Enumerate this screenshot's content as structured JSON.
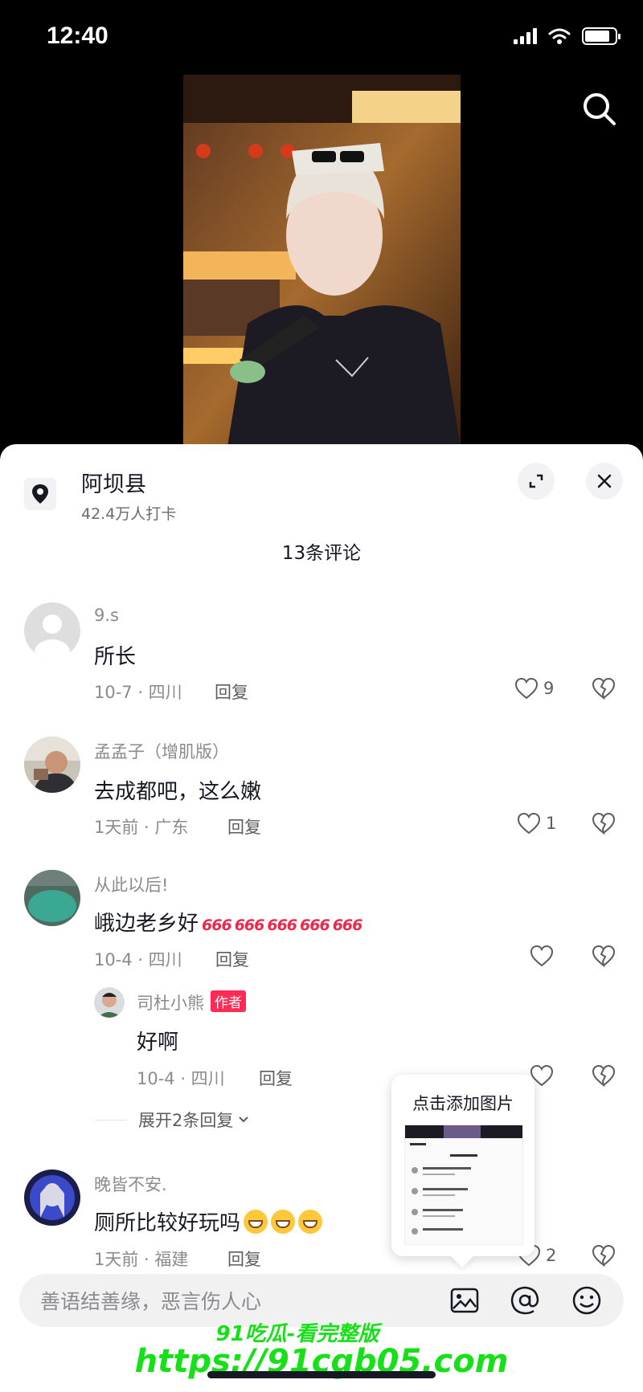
{
  "status_bar": {
    "time": "12:40"
  },
  "location": {
    "name": "阿坝县",
    "checkins": "42.4万人打卡"
  },
  "comments_header": {
    "count_label": "13条评论"
  },
  "comments": [
    {
      "username": "9.s",
      "text": "所长",
      "date_region": "10-7 · 四川",
      "reply_label": "回复",
      "likes": "9"
    },
    {
      "username": "孟孟子（增肌版）",
      "text": "去成都吧，这么嫩",
      "date_region": "1天前 · 广东",
      "reply_label": "回复",
      "likes": "1"
    },
    {
      "username": "从此以后!",
      "text": "峨边老乡好",
      "emoji": "666",
      "date_region": "10-4 · 四川",
      "reply_label": "回复",
      "likes": ""
    },
    {
      "username": "晚皆不安.",
      "text": "厕所比较好玩吗",
      "date_region": "1天前 · 福建",
      "reply_label": "回复",
      "likes": "2"
    }
  ],
  "reply": {
    "username": "司杜小熊",
    "badge": "作者",
    "text": "好啊",
    "date_region": "10-4 · 四川",
    "reply_label": "回复"
  },
  "expand_replies": {
    "label": "展开2条回复"
  },
  "tooltip": {
    "text": "点击添加图片"
  },
  "input": {
    "placeholder": "善语结善缘，恶言伤人心"
  },
  "watermark": {
    "line1": "91吃瓜-看完整版",
    "line2": "https://91cgb05.com"
  },
  "icons": [
    "search-icon",
    "location-pin-icon",
    "expand-icon",
    "close-icon",
    "heart-icon",
    "broken-heart-icon",
    "image-icon",
    "at-icon",
    "emoji-icon",
    "chevron-down-icon"
  ],
  "colors": {
    "accent": "#fe2c55",
    "text": "#161823",
    "secondary": "#8a8a8f",
    "watermark": "#18e018"
  }
}
